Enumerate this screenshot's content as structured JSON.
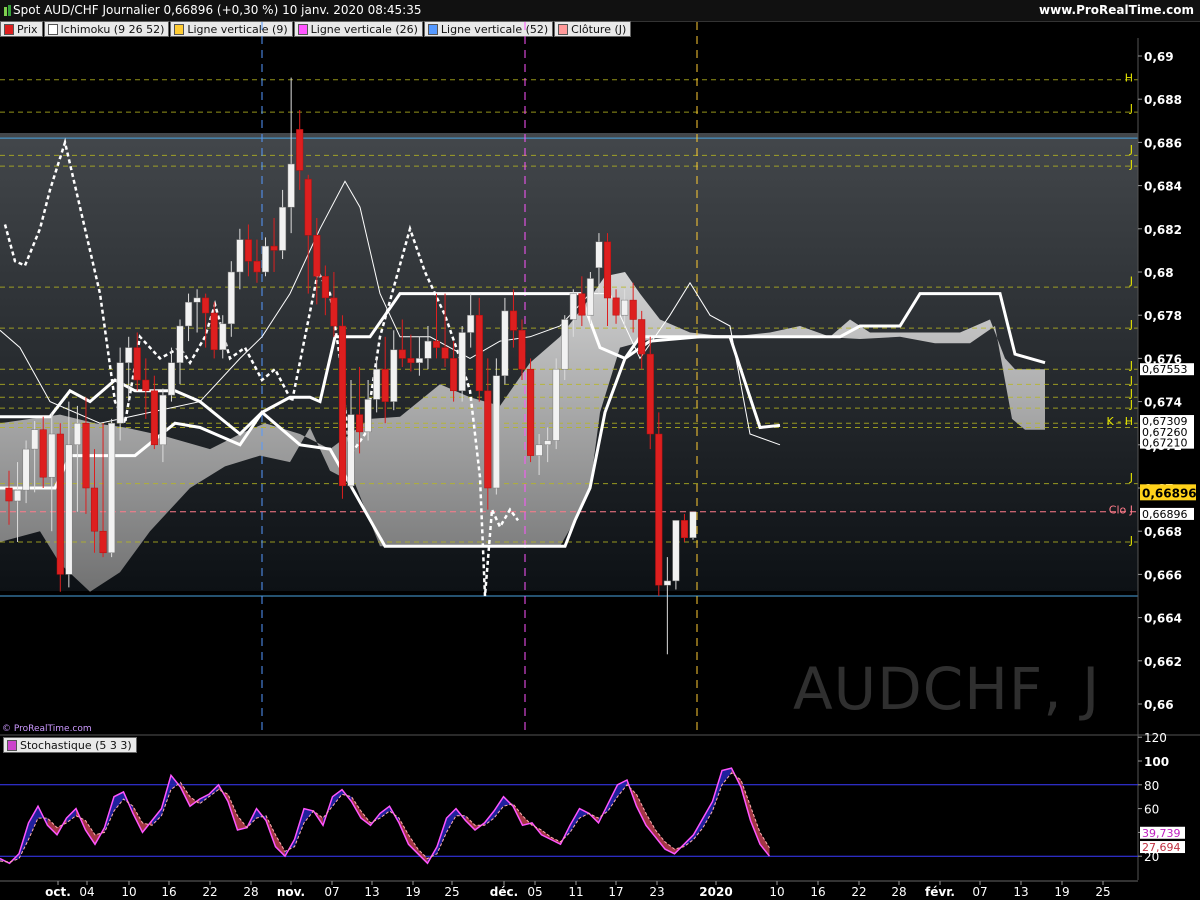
{
  "header": {
    "title": "Spot AUD/CHF Journalier 0,66896 (+0,30 %) 10 janv. 2020 08:45:35",
    "site": "www.ProRealTime.com"
  },
  "legend": [
    {
      "label": "Prix",
      "color": "#dd1f1f"
    },
    {
      "label": "Ichimoku (9 26 52)",
      "color": "#ffffff"
    },
    {
      "label": "Ligne verticale (9)",
      "color": "#ffcc33"
    },
    {
      "label": "Ligne verticale (26)",
      "color": "#ff55ff"
    },
    {
      "label": "Ligne verticale (52)",
      "color": "#5599ff"
    },
    {
      "label": "Clôture (J)",
      "color": "#ff9999"
    }
  ],
  "watermark": "AUDCHF, J",
  "copyright": "© ProRealTime.com",
  "stochastic": {
    "label": "Stochastique (5 3 3)",
    "color": "#cc44cc"
  },
  "chart_data": [
    {
      "type": "candlestick",
      "title": "Spot AUD/CHF Journalier",
      "ylim": [
        0.6588,
        0.6909
      ],
      "yticks": [
        "0,66",
        "0,662",
        "0,664",
        "0,666",
        "0,668",
        "0,67",
        "0,672",
        "0,674",
        "0,676",
        "0,678",
        "0,68",
        "0,682",
        "0,684",
        "0,686",
        "0,688",
        "0,69"
      ],
      "xticks": [
        {
          "label": "oct.",
          "bold": true
        },
        {
          "label": "04"
        },
        {
          "label": "10"
        },
        {
          "label": "16"
        },
        {
          "label": "22"
        },
        {
          "label": "28"
        },
        {
          "label": "nov.",
          "bold": true
        },
        {
          "label": "07"
        },
        {
          "label": "13"
        },
        {
          "label": "19"
        },
        {
          "label": "25"
        },
        {
          "label": "déc.",
          "bold": true
        },
        {
          "label": "05"
        },
        {
          "label": "11"
        },
        {
          "label": "17"
        },
        {
          "label": "23"
        },
        {
          "label": "2020",
          "bold": true
        },
        {
          "label": "10"
        },
        {
          "label": "16"
        },
        {
          "label": "22"
        },
        {
          "label": "28"
        },
        {
          "label": "févr.",
          "bold": true
        },
        {
          "label": "07"
        },
        {
          "label": "13"
        },
        {
          "label": "19"
        },
        {
          "label": "25"
        }
      ],
      "last_price": "0,66896",
      "candles": [
        [
          0.67,
          0.6708,
          0.6683,
          0.6694
        ],
        [
          0.6694,
          0.6712,
          0.6675,
          0.6699
        ],
        [
          0.6699,
          0.6722,
          0.6693,
          0.6718
        ],
        [
          0.6718,
          0.6731,
          0.6698,
          0.6727
        ],
        [
          0.6727,
          0.6733,
          0.67,
          0.6705
        ],
        [
          0.6705,
          0.6735,
          0.668,
          0.6725
        ],
        [
          0.6725,
          0.673,
          0.6652,
          0.666
        ],
        [
          0.666,
          0.674,
          0.6654,
          0.672
        ],
        [
          0.672,
          0.6738,
          0.6689,
          0.673
        ],
        [
          0.673,
          0.6742,
          0.6688,
          0.67
        ],
        [
          0.67,
          0.6718,
          0.667,
          0.668
        ],
        [
          0.668,
          0.673,
          0.6668,
          0.667
        ],
        [
          0.667,
          0.6732,
          0.6668,
          0.673
        ],
        [
          0.673,
          0.6765,
          0.6722,
          0.6758
        ],
        [
          0.6758,
          0.677,
          0.674,
          0.6765
        ],
        [
          0.6765,
          0.6772,
          0.6745,
          0.675
        ],
        [
          0.675,
          0.676,
          0.6732,
          0.6745
        ],
        [
          0.6745,
          0.6752,
          0.6718,
          0.672
        ],
        [
          0.672,
          0.6746,
          0.6712,
          0.6743
        ],
        [
          0.6743,
          0.6765,
          0.674,
          0.6758
        ],
        [
          0.6758,
          0.6778,
          0.6748,
          0.6775
        ],
        [
          0.6775,
          0.679,
          0.6768,
          0.6786
        ],
        [
          0.6786,
          0.6792,
          0.6772,
          0.6788
        ],
        [
          0.6788,
          0.679,
          0.6765,
          0.6781
        ],
        [
          0.6781,
          0.6786,
          0.676,
          0.6764
        ],
        [
          0.6764,
          0.678,
          0.676,
          0.6776
        ],
        [
          0.6776,
          0.6805,
          0.677,
          0.68
        ],
        [
          0.68,
          0.682,
          0.6792,
          0.6815
        ],
        [
          0.6815,
          0.6822,
          0.6798,
          0.6805
        ],
        [
          0.6805,
          0.6815,
          0.6795,
          0.68
        ],
        [
          0.68,
          0.6816,
          0.6798,
          0.6812
        ],
        [
          0.6812,
          0.6825,
          0.68,
          0.681
        ],
        [
          0.681,
          0.6838,
          0.6806,
          0.683
        ],
        [
          0.683,
          0.689,
          0.6818,
          0.685
        ],
        [
          0.6866,
          0.6875,
          0.6838,
          0.6847
        ],
        [
          0.6843,
          0.6845,
          0.679,
          0.6817
        ],
        [
          0.6817,
          0.6825,
          0.6785,
          0.6798
        ],
        [
          0.6798,
          0.6803,
          0.678,
          0.6788
        ],
        [
          0.6788,
          0.68,
          0.677,
          0.6775
        ],
        [
          0.6775,
          0.678,
          0.6695,
          0.6701
        ],
        [
          0.6701,
          0.675,
          0.67,
          0.6734
        ],
        [
          0.6734,
          0.6756,
          0.6716,
          0.6726
        ],
        [
          0.6726,
          0.675,
          0.6722,
          0.6741
        ],
        [
          0.6741,
          0.676,
          0.6735,
          0.6755
        ],
        [
          0.6755,
          0.677,
          0.673,
          0.674
        ],
        [
          0.674,
          0.6773,
          0.6736,
          0.6764
        ],
        [
          0.6764,
          0.6778,
          0.6756,
          0.676
        ],
        [
          0.676,
          0.6771,
          0.6754,
          0.6758
        ],
        [
          0.6758,
          0.677,
          0.6752,
          0.676
        ],
        [
          0.676,
          0.6775,
          0.6755,
          0.6768
        ],
        [
          0.6768,
          0.679,
          0.676,
          0.6765
        ],
        [
          0.6765,
          0.679,
          0.6756,
          0.676
        ],
        [
          0.676,
          0.6768,
          0.674,
          0.6745
        ],
        [
          0.6745,
          0.6775,
          0.674,
          0.6772
        ],
        [
          0.6772,
          0.679,
          0.6765,
          0.678
        ],
        [
          0.678,
          0.6788,
          0.674,
          0.6745
        ],
        [
          0.6745,
          0.676,
          0.669,
          0.67
        ],
        [
          0.67,
          0.676,
          0.6697,
          0.6752
        ],
        [
          0.6752,
          0.6788,
          0.6748,
          0.6782
        ],
        [
          0.6782,
          0.6792,
          0.6765,
          0.6773
        ],
        [
          0.6773,
          0.6778,
          0.675,
          0.6755
        ],
        [
          0.6755,
          0.676,
          0.6712,
          0.6715
        ],
        [
          0.6715,
          0.6725,
          0.6706,
          0.672
        ],
        [
          0.672,
          0.6728,
          0.6712,
          0.6722
        ],
        [
          0.6722,
          0.676,
          0.6718,
          0.6755
        ],
        [
          0.6755,
          0.678,
          0.675,
          0.6778
        ],
        [
          0.6778,
          0.6792,
          0.677,
          0.679
        ],
        [
          0.679,
          0.6798,
          0.6775,
          0.678
        ],
        [
          0.678,
          0.68,
          0.6776,
          0.6797
        ],
        [
          0.6802,
          0.6818,
          0.679,
          0.6814
        ],
        [
          0.6814,
          0.6818,
          0.6775,
          0.6788
        ],
        [
          0.6788,
          0.6792,
          0.6776,
          0.678
        ],
        [
          0.678,
          0.6792,
          0.6774,
          0.6787
        ],
        [
          0.6787,
          0.6795,
          0.6772,
          0.6778
        ],
        [
          0.6778,
          0.6782,
          0.6755,
          0.6762
        ],
        [
          0.6762,
          0.677,
          0.6718,
          0.6725
        ],
        [
          0.6725,
          0.6735,
          0.665,
          0.6655
        ],
        [
          0.6655,
          0.6668,
          0.6623,
          0.6657
        ],
        [
          0.6657,
          0.6684,
          0.6653,
          0.6685
        ],
        [
          0.6685,
          0.6688,
          0.6675,
          0.6677
        ],
        [
          0.6677,
          0.6689,
          0.6676,
          0.6689
        ]
      ],
      "series": [
        {
          "name": "Ichimoku (9 26 52)",
          "x": [
            0,
            8,
            12,
            19,
            26,
            35,
            39,
            42,
            48,
            54,
            60,
            63,
            67,
            72,
            76
          ],
          "values": [
            0.6728,
            0.6728,
            0.6728,
            0.6733,
            0.6728,
            0.6718,
            0.6732,
            0.675,
            0.6758,
            0.6768,
            0.678,
            0.6768,
            0.6776,
            0.6768,
            0.6712
          ]
        },
        {
          "name": "Clôture (J)",
          "y": 0.6689
        }
      ],
      "levels": [
        "0,67553",
        "0,67309",
        "0,67260",
        "0,67210",
        "0,66896"
      ],
      "level_tags": [
        "H",
        "J",
        "J",
        "J",
        "J",
        "J",
        "J",
        "J",
        "J",
        "J",
        "K - H",
        "J",
        "Clo J",
        "J"
      ]
    },
    {
      "type": "line",
      "title": "Stochastique (5 3 3)",
      "ylim": [
        0,
        120
      ],
      "yticks": [
        "20",
        "40",
        "60",
        "80",
        "100",
        "120"
      ],
      "values_k": [
        18,
        14,
        22,
        48,
        62,
        46,
        38,
        52,
        60,
        42,
        30,
        44,
        70,
        74,
        56,
        40,
        50,
        60,
        88,
        78,
        62,
        68,
        72,
        80,
        66,
        42,
        44,
        60,
        50,
        28,
        20,
        34,
        60,
        58,
        46,
        70,
        76,
        66,
        52,
        46,
        56,
        62,
        48,
        30,
        22,
        14,
        28,
        52,
        60,
        50,
        42,
        48,
        58,
        70,
        62,
        46,
        48,
        38,
        34,
        30,
        46,
        60,
        56,
        48,
        64,
        80,
        84,
        62,
        46,
        36,
        26,
        22,
        30,
        38,
        52,
        66,
        92,
        94,
        78,
        50,
        30,
        20
      ],
      "values_d": [
        16,
        15,
        18,
        34,
        52,
        52,
        44,
        48,
        54,
        50,
        38,
        40,
        58,
        68,
        62,
        48,
        46,
        54,
        76,
        82,
        70,
        64,
        70,
        76,
        72,
        54,
        44,
        52,
        54,
        38,
        24,
        28,
        48,
        58,
        52,
        62,
        72,
        70,
        58,
        48,
        52,
        58,
        52,
        38,
        26,
        18,
        22,
        40,
        54,
        54,
        46,
        46,
        52,
        62,
        64,
        54,
        46,
        42,
        36,
        32,
        40,
        52,
        56,
        52,
        58,
        70,
        80,
        72,
        56,
        42,
        32,
        26,
        28,
        34,
        44,
        58,
        80,
        90,
        84,
        62,
        40,
        27
      ],
      "last_k": "39,739",
      "last_d": "27,694"
    }
  ]
}
